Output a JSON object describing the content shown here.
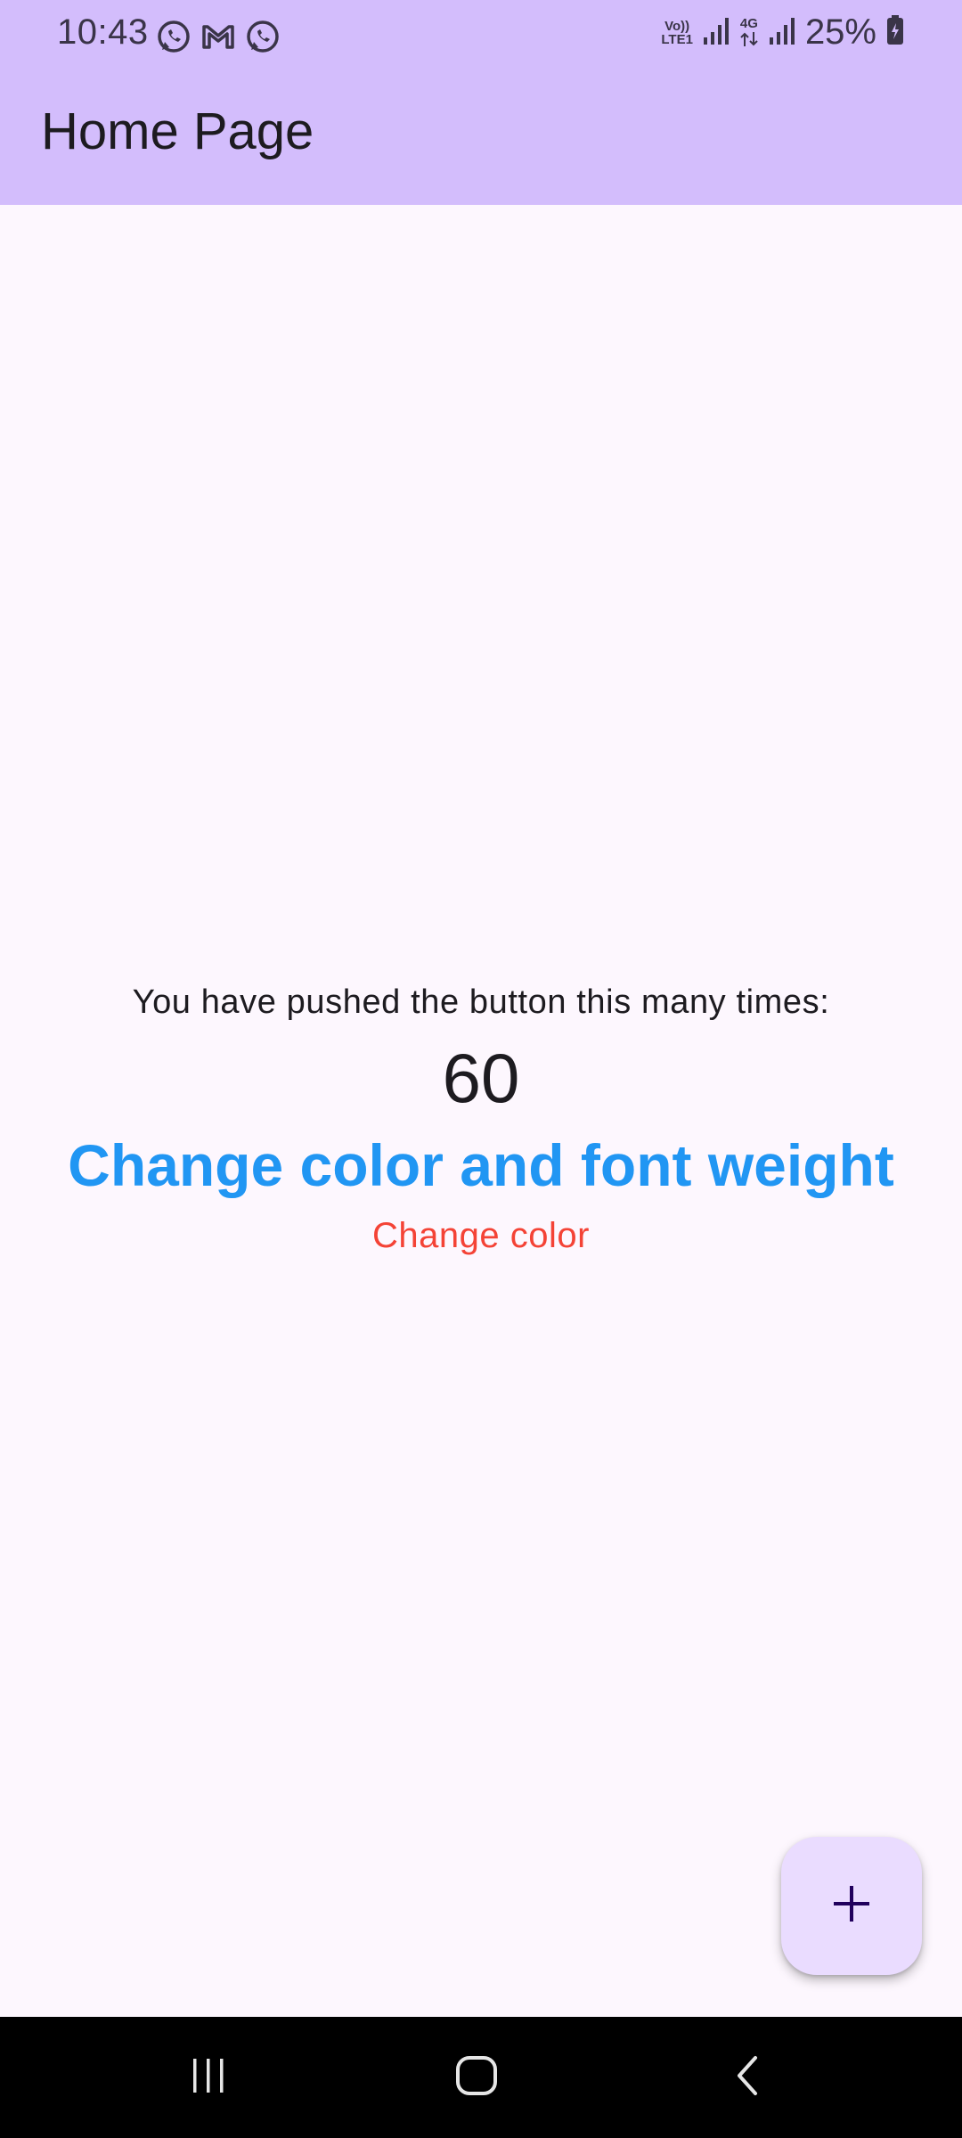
{
  "status_bar": {
    "time": "10:43",
    "left_icons": [
      "whatsapp-icon",
      "gmail-icon",
      "whatsapp-icon"
    ],
    "volte_label_top": "Vo))",
    "volte_label_bottom": "LTE1",
    "network_label": "4G",
    "battery_percent": "25%"
  },
  "app_bar": {
    "title": "Home Page",
    "background_color": "#d3bdfc"
  },
  "body": {
    "pushed_text": "You have pushed the button this many times:",
    "counter": "60",
    "styled_text_1": "Change color and font weight",
    "styled_text_1_color": "#2196f3",
    "styled_text_2": "Change color",
    "styled_text_2_color": "#f44336"
  },
  "fab": {
    "icon": "plus-icon",
    "background_color": "#eadcff"
  },
  "nav_bar": {
    "buttons": [
      "recent-apps-icon",
      "home-icon",
      "back-icon"
    ]
  }
}
